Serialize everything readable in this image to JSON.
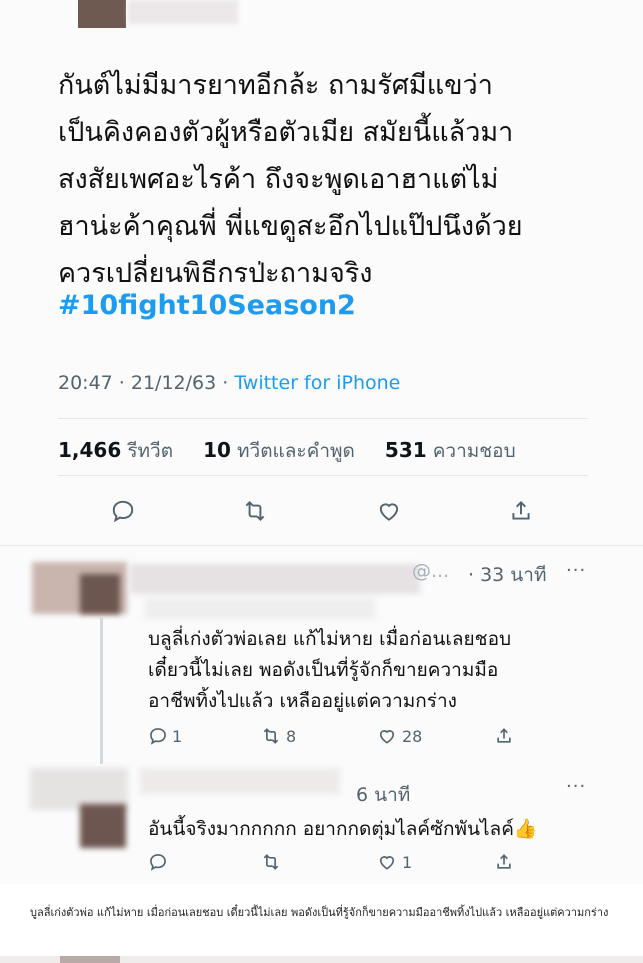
{
  "tweet": {
    "lines": [
      "กันต์ไม่มีมารยาทอีกล้ะ ถามรัศมีแขว่า",
      "เป็นคิงคองตัวผู้หรือตัวเมีย สมัยนี้แล้วมา",
      "สงสัยเพศอะไรค้า ถึงจะพูดเอาฮาแต่ไม่",
      "ฮาน่ะค้าคุณพี่ พี่แขดูสะอึกไปแป๊ปนึงด้วย",
      "ควรเปลี่ยนพิธีกรป่ะถามจริง"
    ],
    "hashtag": "#10fight10Season2",
    "time": "20:47 · 21/12/63 · ",
    "source": "Twitter for iPhone",
    "stats": {
      "retweets_count": "1,466",
      "retweets_label": "รีทวีต",
      "quotes_count": "10",
      "quotes_label": "ทวีตและคำพูด",
      "likes_count": "531",
      "likes_label": "ความชอบ"
    }
  },
  "replies": [
    {
      "time": "· 33 นาที",
      "partial_handle": "@...",
      "more": "···",
      "lines": [
        "บลูลี่เก่งตัวพ่อเลย แก้ไม่หาย เมื่อก่อนเลยชอบ",
        "เดี๋ยวนี้ไม่เลย พอดังเป็นที่รู้จักก็ขายความมือ",
        "อาชีพทิ้งไปแล้ว เหลืออยู่แต่ความกร่าง"
      ],
      "reply_count": "1",
      "retweet_count": "8",
      "like_count": "28"
    },
    {
      "time": "6 นาที",
      "more": "···",
      "lines": [
        "อันนี้จริงมากกกกก อยากกดตุ่มไลค์ซักพันไลค์👍"
      ],
      "reply_count": "",
      "retweet_count": "",
      "like_count": "1"
    }
  ],
  "caption": "บูลลี่เก่งตัวพ่อ แก้ไม่หาย เมื่อก่อนเลยชอบ เดี๋ยวนี้ไม่เลย พอดังเป็นที่รู้จักก็ขายความมืออาชีพทิ้งไปแล้ว เหลืออยู่แต่ความกร่าง",
  "icons": [
    "reply-icon",
    "retweet-icon",
    "like-icon",
    "share-icon",
    "more-icon"
  ],
  "colors": {
    "link": "#1d9bf0",
    "muted": "#536471",
    "text": "#0f1419"
  }
}
